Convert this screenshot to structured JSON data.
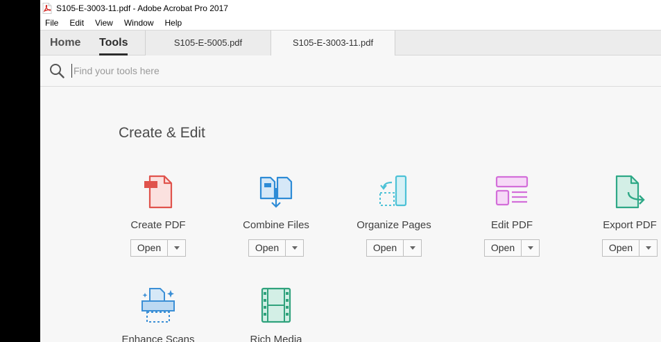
{
  "window": {
    "title": "S105-E-3003-11.pdf - Adobe Acrobat Pro 2017"
  },
  "menu": [
    "File",
    "Edit",
    "View",
    "Window",
    "Help"
  ],
  "nav": {
    "home": "Home",
    "tools": "Tools"
  },
  "doc_tabs": [
    "S105-E-5005.pdf",
    "S105-E-3003-11.pdf"
  ],
  "search": {
    "placeholder": "Find your tools here",
    "value": ""
  },
  "section": {
    "title": "Create & Edit"
  },
  "tools": [
    {
      "label": "Create PDF",
      "icon": "create-pdf-icon",
      "open": "Open"
    },
    {
      "label": "Combine Files",
      "icon": "combine-files-icon",
      "open": "Open"
    },
    {
      "label": "Organize Pages",
      "icon": "organize-pages-icon",
      "open": "Open"
    },
    {
      "label": "Edit PDF",
      "icon": "edit-pdf-icon",
      "open": "Open"
    },
    {
      "label": "Export PDF",
      "icon": "export-pdf-icon",
      "open": "Open"
    },
    {
      "label": "Enhance Scans",
      "icon": "enhance-scans-icon"
    },
    {
      "label": "Rich Media",
      "icon": "rich-media-icon"
    }
  ],
  "colors": {
    "create_pdf": "#e0534c",
    "combine_files": "#2d8bd6",
    "organize_pages": "#4cc1d6",
    "edit_pdf": "#d36ed9",
    "export_pdf": "#2ea886",
    "enhance_scans": "#3b8fd6",
    "rich_media": "#2fa27c"
  }
}
